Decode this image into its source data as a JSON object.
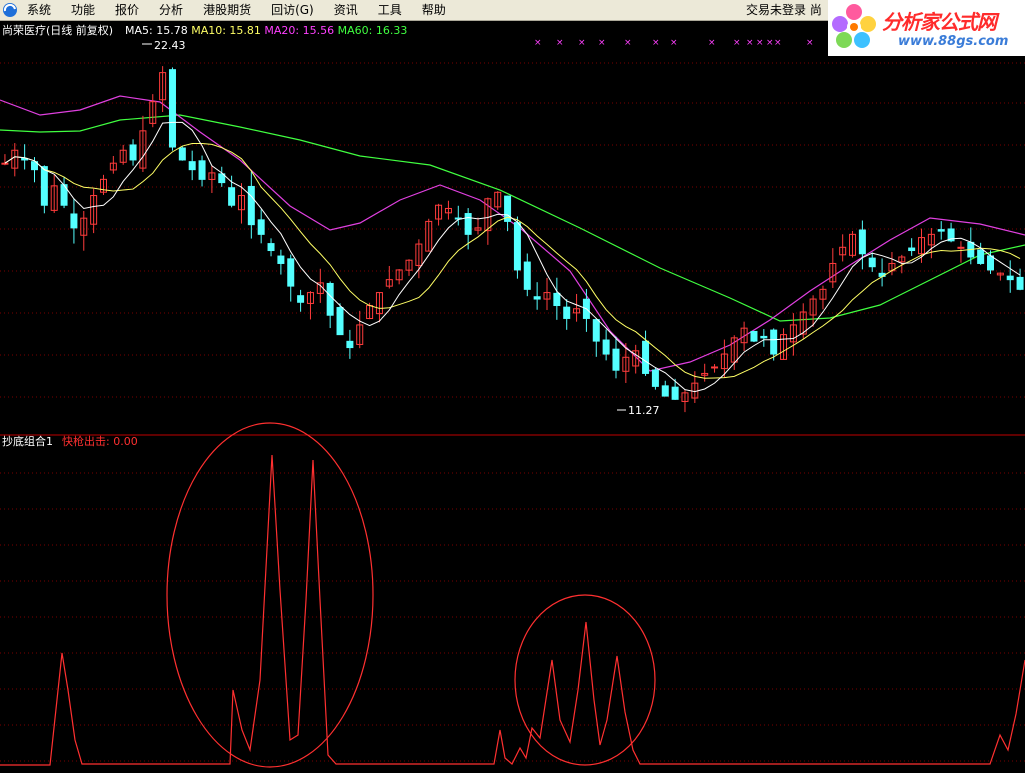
{
  "menubar": {
    "items": [
      "系统",
      "功能",
      "报价",
      "分析",
      "港股期货",
      "回访(G)",
      "资讯",
      "工具",
      "帮助"
    ],
    "trade_status": "交易未登录",
    "trade_extra": "尚"
  },
  "brand": {
    "name": "分析家公式网",
    "url": "www.88gs.com"
  },
  "main_panel": {
    "stock_name": "尚荣医疗",
    "period": "(日线 前复权)",
    "ma": [
      {
        "label": "MA5: 15.78",
        "color": "#ffffff"
      },
      {
        "label": "MA10: 15.81",
        "color": "#ffff66"
      },
      {
        "label": "MA20: 15.56",
        "color": "#ff40ff"
      },
      {
        "label": "MA60: 16.33",
        "color": "#40ff40"
      }
    ],
    "high_label": "22.43",
    "low_label": "11.27",
    "marker": "×",
    "marker_color": "#ff40ff"
  },
  "indicator_panel": {
    "name": "抄底组合1",
    "series_label": "快枪出击: 0.00",
    "series_color": "#ff3030"
  },
  "colors": {
    "background": "#000000",
    "grid": "#7a0000",
    "up_candle": "#ff3c3c",
    "down_candle": "#54ffff",
    "panel_border": "#c00000"
  },
  "chart_data": {
    "type": "candlestick",
    "y_range": [
      11.27,
      22.43
    ],
    "price_series": [
      18.9,
      19.3,
      19.0,
      18.7,
      17.6,
      18.2,
      17.6,
      16.9,
      17.2,
      17.9,
      18.4,
      18.9,
      19.3,
      19.0,
      19.9,
      20.8,
      21.7,
      19.4,
      19.0,
      18.7,
      18.4,
      18.6,
      18.3,
      17.6,
      17.9,
      17.0,
      16.7,
      16.2,
      15.8,
      15.1,
      14.6,
      14.9,
      15.2,
      14.2,
      13.6,
      13.2,
      13.9,
      14.5,
      14.9,
      15.3,
      15.6,
      15.9,
      16.4,
      17.1,
      17.6,
      17.5,
      17.2,
      16.7,
      16.9,
      17.8,
      18.0,
      17.1,
      15.6,
      15.0,
      14.7,
      14.9,
      14.5,
      14.1,
      14.4,
      14.1,
      13.4,
      13.0,
      12.5,
      12.9,
      13.1,
      12.4,
      12.0,
      11.7,
      11.6,
      11.8,
      12.1,
      12.4,
      12.6,
      13.0,
      13.5,
      13.8,
      13.4,
      13.5,
      13.0,
      13.6,
      13.9,
      14.3,
      14.7,
      15.0,
      15.8,
      16.3,
      16.7,
      16.1,
      15.7,
      15.4,
      15.8,
      16.0,
      16.2,
      16.6,
      16.7,
      16.8,
      16.5,
      16.3,
      16.0,
      15.8,
      15.6,
      15.5,
      15.3,
      15.0
    ],
    "ma60_points": [
      [
        0,
        130
      ],
      [
        40,
        132
      ],
      [
        80,
        131
      ],
      [
        120,
        120
      ],
      [
        180,
        115
      ],
      [
        240,
        127
      ],
      [
        300,
        140
      ],
      [
        360,
        156
      ],
      [
        430,
        165
      ],
      [
        500,
        190
      ],
      [
        580,
        228
      ],
      [
        660,
        268
      ],
      [
        730,
        298
      ],
      [
        780,
        321
      ],
      [
        830,
        318
      ],
      [
        880,
        305
      ],
      [
        930,
        280
      ],
      [
        980,
        255
      ],
      [
        1025,
        245
      ]
    ],
    "ma20_points": [
      [
        0,
        100
      ],
      [
        40,
        115
      ],
      [
        80,
        110
      ],
      [
        120,
        96
      ],
      [
        160,
        102
      ],
      [
        200,
        132
      ],
      [
        240,
        160
      ],
      [
        290,
        206
      ],
      [
        330,
        230
      ],
      [
        360,
        223
      ],
      [
        400,
        200
      ],
      [
        440,
        185
      ],
      [
        480,
        200
      ],
      [
        520,
        228
      ],
      [
        570,
        271
      ],
      [
        610,
        331
      ],
      [
        650,
        371
      ],
      [
        690,
        362
      ],
      [
        730,
        345
      ],
      [
        770,
        320
      ],
      [
        810,
        291
      ],
      [
        850,
        265
      ],
      [
        890,
        240
      ],
      [
        930,
        218
      ],
      [
        980,
        224
      ],
      [
        1025,
        235
      ]
    ],
    "indicator_points": [
      [
        0,
        765
      ],
      [
        50,
        765
      ],
      [
        62,
        653
      ],
      [
        68,
        690
      ],
      [
        75,
        740
      ],
      [
        82,
        764
      ],
      [
        230,
        764
      ],
      [
        233,
        690
      ],
      [
        242,
        730
      ],
      [
        250,
        750
      ],
      [
        260,
        680
      ],
      [
        272,
        455
      ],
      [
        280,
        590
      ],
      [
        290,
        740
      ],
      [
        298,
        735
      ],
      [
        306,
        600
      ],
      [
        313,
        460
      ],
      [
        320,
        600
      ],
      [
        328,
        755
      ],
      [
        336,
        764
      ],
      [
        494,
        764
      ],
      [
        500,
        730
      ],
      [
        505,
        758
      ],
      [
        512,
        764
      ],
      [
        520,
        748
      ],
      [
        526,
        758
      ],
      [
        532,
        728
      ],
      [
        540,
        738
      ],
      [
        552,
        660
      ],
      [
        560,
        720
      ],
      [
        570,
        742
      ],
      [
        578,
        690
      ],
      [
        586,
        622
      ],
      [
        594,
        700
      ],
      [
        600,
        745
      ],
      [
        607,
        720
      ],
      [
        617,
        656
      ],
      [
        625,
        712
      ],
      [
        633,
        750
      ],
      [
        640,
        764
      ],
      [
        990,
        764
      ],
      [
        1000,
        735
      ],
      [
        1008,
        750
      ],
      [
        1016,
        714
      ],
      [
        1025,
        660
      ]
    ],
    "indicator_circles": [
      [
        270,
        595,
        103,
        172
      ],
      [
        585,
        680,
        70,
        85
      ]
    ]
  }
}
